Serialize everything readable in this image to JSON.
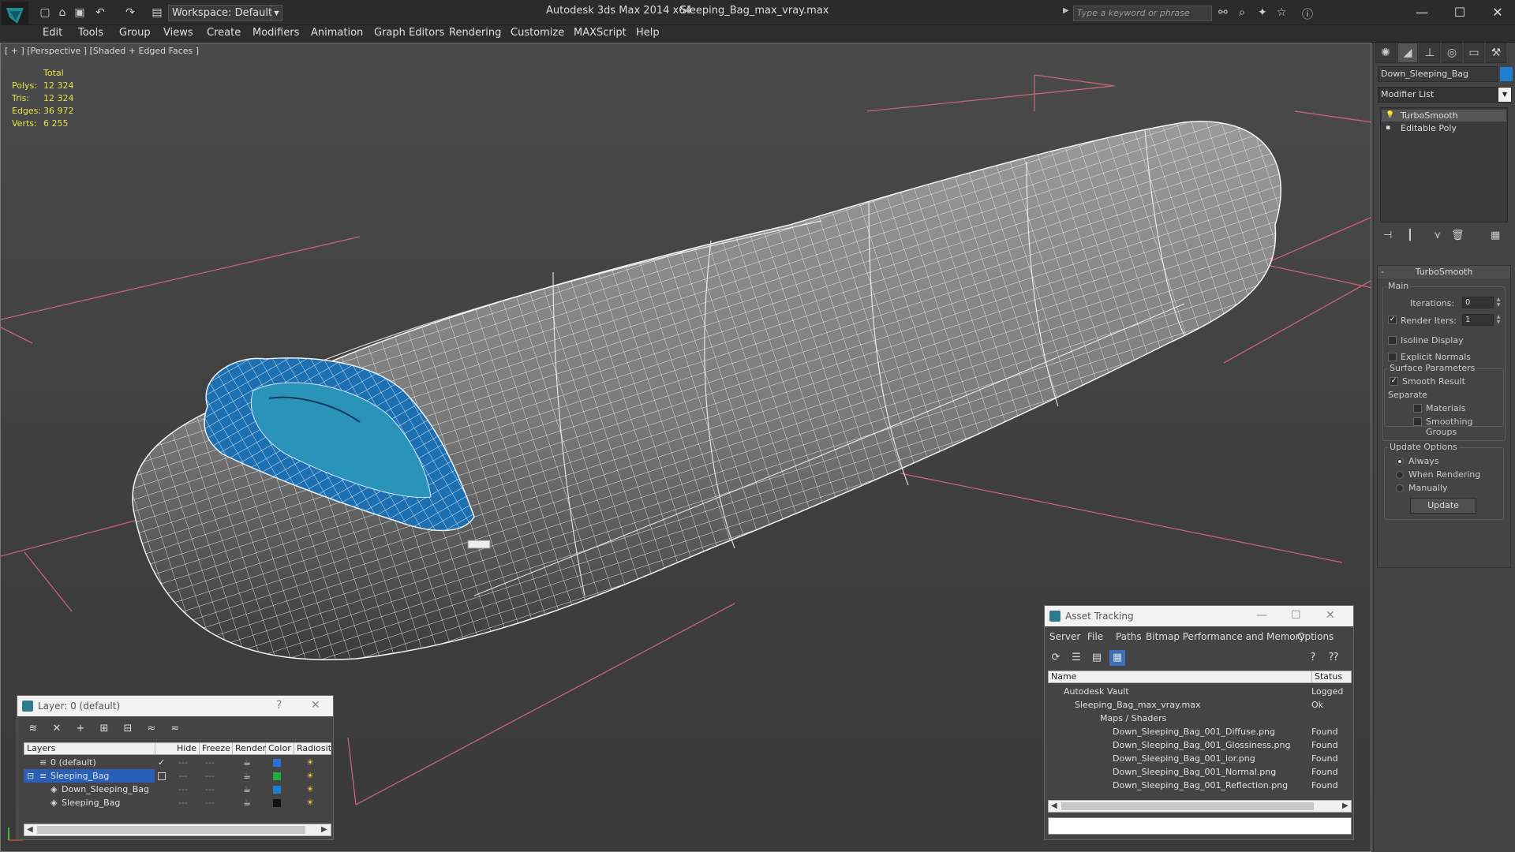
{
  "titlebar": {
    "workspace": "Workspace: Default",
    "app_title": "Autodesk 3ds Max  2014 x64",
    "file_title": "Sleeping_Bag_max_vray.max",
    "search_placeholder": "Type a keyword or phrase"
  },
  "menu": [
    "Edit",
    "Tools",
    "Group",
    "Views",
    "Create",
    "Modifiers",
    "Animation",
    "Graph Editors",
    "Rendering",
    "Customize",
    "MAXScript",
    "Help"
  ],
  "viewport": {
    "label": "[ + ] [Perspective ] [Shaded + Edged Faces ]",
    "stats": {
      "header": "Total",
      "rows": [
        {
          "k": "Polys:",
          "v": "12 324"
        },
        {
          "k": "Tris:",
          "v": "12 324"
        },
        {
          "k": "Edges:",
          "v": "36 972"
        },
        {
          "k": "Verts:",
          "v": "6 255"
        }
      ]
    }
  },
  "command_panel": {
    "object_name": "Down_Sleeping_Bag",
    "object_color": "#1e7fd1",
    "modifier_list": "Modifier List",
    "stack": [
      "TurboSmooth",
      "Editable Poly"
    ],
    "rollout_title": "TurboSmooth",
    "main_group": "Main",
    "iterations_label": "Iterations:",
    "iterations_value": "0",
    "render_iters_label": "Render Iters:",
    "render_iters_value": "1",
    "isoline": "Isoline Display",
    "explicit_normals": "Explicit Normals",
    "surface_group": "Surface Parameters",
    "smooth_result": "Smooth Result",
    "separate_label": "Separate",
    "materials": "Materials",
    "smoothing_groups": "Smoothing Groups",
    "update_group": "Update Options",
    "always": "Always",
    "when_rendering": "When Rendering",
    "manually": "Manually",
    "update_button": "Update"
  },
  "asset_tracking": {
    "title": "Asset Tracking",
    "menu": [
      "Server",
      "File",
      "Paths",
      "Bitmap Performance and Memory",
      "Options"
    ],
    "col_name": "Name",
    "col_status": "Status",
    "rows": [
      {
        "name": "Autodesk Vault",
        "status": "Logged",
        "indent": 0
      },
      {
        "name": "Sleeping_Bag_max_vray.max",
        "status": "Ok",
        "indent": 1
      },
      {
        "name": "Maps / Shaders",
        "status": "",
        "indent": 2
      },
      {
        "name": "Down_Sleeping_Bag_001_Diffuse.png",
        "status": "Found",
        "indent": 3
      },
      {
        "name": "Down_Sleeping_Bag_001_Glossiness.png",
        "status": "Found",
        "indent": 3
      },
      {
        "name": "Down_Sleeping_Bag_001_ior.png",
        "status": "Found",
        "indent": 3
      },
      {
        "name": "Down_Sleeping_Bag_001_Normal.png",
        "status": "Found",
        "indent": 3
      },
      {
        "name": "Down_Sleeping_Bag_001_Reflection.png",
        "status": "Found",
        "indent": 3
      }
    ]
  },
  "layer_window": {
    "title": "Layer: 0 (default)",
    "columns": [
      "Layers",
      "Hide",
      "Freeze",
      "Render",
      "Color",
      "Radiosit"
    ],
    "rows": [
      {
        "name": "0 (default)",
        "color": "#2a6fd6",
        "selected": false,
        "indent": 0,
        "active": true
      },
      {
        "name": "Sleeping_Bag",
        "color": "#1fae3a",
        "selected": true,
        "indent": 0,
        "active": false
      },
      {
        "name": "Down_Sleeping_Bag",
        "color": "#1e7fd1",
        "selected": false,
        "indent": 1,
        "active": false
      },
      {
        "name": "Sleeping_Bag",
        "color": "#111111",
        "selected": false,
        "indent": 1,
        "active": false
      }
    ]
  }
}
